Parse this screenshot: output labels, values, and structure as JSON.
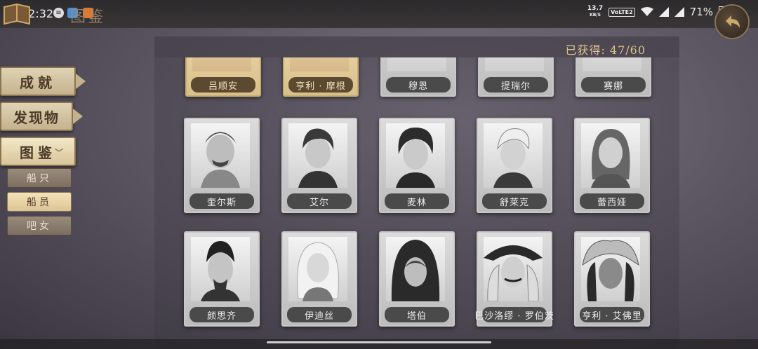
{
  "status_bar": {
    "time": "22:32",
    "net_speed_value": "13.7",
    "net_speed_unit": "KB/S",
    "volte": "VoLTE2",
    "battery_pct": "71%"
  },
  "header": {
    "title": "图鉴"
  },
  "nav": {
    "tabs": [
      {
        "label": "成就"
      },
      {
        "label": "发现物"
      },
      {
        "label": "图鉴"
      }
    ],
    "sub_tabs": [
      {
        "label": "船只"
      },
      {
        "label": "船员"
      },
      {
        "label": "吧女"
      }
    ],
    "active_tab": "图鉴",
    "active_sub_tab": "船员"
  },
  "collection": {
    "count_label": "已获得:",
    "count_value": "47/60"
  },
  "cards": {
    "row1": [
      "吕顺安",
      "亨利 · 摩根",
      "穆恩",
      "提瑞尔",
      "赛娜"
    ],
    "row2": [
      "奎尔斯",
      "艾尔",
      "麦林",
      "舒莱克",
      "蕾西娅"
    ],
    "row3": [
      "颜思齐",
      "伊迪丝",
      "塔伯",
      "巴沙洛缪 · 罗伯茨",
      "亨利 · 艾佛里"
    ]
  },
  "colors": {
    "accent_gold": "#dcc38d",
    "tab_parchment": "#e0d3b4"
  }
}
